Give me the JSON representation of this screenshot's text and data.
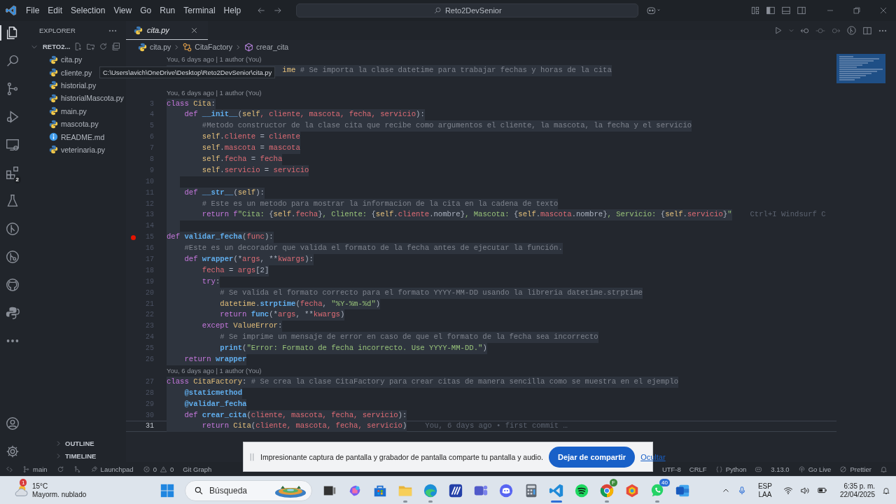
{
  "window": {
    "title": "Reto2DevSenior"
  },
  "menu": [
    "File",
    "Edit",
    "Selection",
    "View",
    "Go",
    "Run",
    "Terminal",
    "Help"
  ],
  "activity_bar": {
    "items": [
      {
        "kind": "files",
        "selected": true
      },
      {
        "kind": "search",
        "selected": false
      },
      {
        "kind": "scm",
        "selected": false
      },
      {
        "kind": "debug",
        "selected": false
      },
      {
        "kind": "remote",
        "selected": false
      },
      {
        "kind": "extensions",
        "selected": false,
        "badge": "2"
      },
      {
        "kind": "testing",
        "selected": false
      },
      {
        "kind": "gitgraph",
        "selected": false
      },
      {
        "kind": "gitlens",
        "selected": false
      },
      {
        "kind": "github",
        "selected": false
      },
      {
        "kind": "python",
        "selected": false
      },
      {
        "kind": "more",
        "selected": false
      }
    ],
    "bottom": [
      {
        "kind": "account"
      },
      {
        "kind": "settings"
      }
    ]
  },
  "sidebar": {
    "title": "EXPLORER",
    "folder": {
      "label": "RETO2...",
      "expanded": true
    },
    "files": [
      {
        "name": "cita.py",
        "kind": "python"
      },
      {
        "name": "cliente.py",
        "kind": "python"
      },
      {
        "name": "historial.py",
        "kind": "python"
      },
      {
        "name": "historialMascota.py",
        "kind": "python"
      },
      {
        "name": "main.py",
        "kind": "python"
      },
      {
        "name": "mascota.py",
        "kind": "python"
      },
      {
        "name": "README.md",
        "kind": "info"
      },
      {
        "name": "veterinaria.py",
        "kind": "python"
      }
    ],
    "sections": [
      {
        "label": "OUTLINE",
        "expanded": false
      },
      {
        "label": "TIMELINE",
        "expanded": false
      }
    ]
  },
  "tooltip": {
    "text": "C:\\Users\\avich\\OneDrive\\Desktop\\Reto2DevSenior\\cita.py"
  },
  "editor": {
    "tabs": [
      {
        "label": "cita.py",
        "selected": true,
        "preview": true
      }
    ],
    "breadcrumb": [
      {
        "label": "cita.py",
        "kind": "file"
      },
      {
        "label": "CitaFactory",
        "kind": "class"
      },
      {
        "label": "crear_cita",
        "kind": "method"
      }
    ],
    "rows": [
      {
        "kind": "lens",
        "text": "You, 6 days ago | 1 author (You)"
      },
      {
        "kind": "code",
        "selected": true,
        "current": false,
        "breakpoint": false,
        "tokens": [
          {
            "kind": "c",
            "text": "                          ime"
          },
          {
            "kind": "m",
            "text": " # Se importa la clase datetime para trabajar fechas y horas de la cita"
          }
        ]
      },
      {
        "kind": "code",
        "selected": false,
        "current": false,
        "breakpoint": false,
        "tokens": []
      },
      {
        "kind": "lens",
        "text": "You, 6 days ago | 1 author (You)"
      },
      {
        "kind": "code",
        "number": "3",
        "selected": true,
        "current": false,
        "breakpoint": false,
        "tokens": [
          {
            "kind": "k",
            "text": "class"
          },
          {
            "kind": "c",
            "text": " Cita"
          },
          {
            "kind": "t",
            "text": ":"
          }
        ]
      },
      {
        "kind": "code",
        "number": "4",
        "selected": true,
        "current": false,
        "breakpoint": false,
        "tokens": [
          {
            "kind": "k",
            "text": "    def"
          },
          {
            "kind": "f",
            "text": " __init__"
          },
          {
            "kind": "t",
            "text": "("
          },
          {
            "kind": "s",
            "text": "self"
          },
          {
            "kind": "p",
            "text": ", cliente, mascota, fecha, servicio"
          },
          {
            "kind": "t",
            "text": "):"
          }
        ]
      },
      {
        "kind": "code",
        "number": "5",
        "selected": true,
        "current": false,
        "breakpoint": false,
        "tokens": [
          {
            "kind": "m",
            "text": "        #Metodo constructor de la clase cita que recibe como argumentos el cliente, la mascota, la fecha y el servicio"
          }
        ]
      },
      {
        "kind": "code",
        "number": "6",
        "selected": true,
        "current": false,
        "breakpoint": false,
        "tokens": [
          {
            "kind": "s",
            "text": "        self"
          },
          {
            "kind": "t",
            "text": "."
          },
          {
            "kind": "p",
            "text": "cliente"
          },
          {
            "kind": "t",
            "text": " = "
          },
          {
            "kind": "p",
            "text": "cliente"
          }
        ]
      },
      {
        "kind": "code",
        "number": "7",
        "selected": true,
        "current": false,
        "breakpoint": false,
        "tokens": [
          {
            "kind": "s",
            "text": "        self"
          },
          {
            "kind": "t",
            "text": "."
          },
          {
            "kind": "p",
            "text": "mascota"
          },
          {
            "kind": "t",
            "text": " = "
          },
          {
            "kind": "p",
            "text": "mascota"
          }
        ]
      },
      {
        "kind": "code",
        "number": "8",
        "selected": true,
        "current": false,
        "breakpoint": false,
        "tokens": [
          {
            "kind": "s",
            "text": "        self"
          },
          {
            "kind": "t",
            "text": "."
          },
          {
            "kind": "p",
            "text": "fecha"
          },
          {
            "kind": "t",
            "text": " = "
          },
          {
            "kind": "p",
            "text": "fecha"
          }
        ]
      },
      {
        "kind": "code",
        "number": "9",
        "selected": true,
        "current": false,
        "breakpoint": false,
        "tokens": [
          {
            "kind": "s",
            "text": "        self"
          },
          {
            "kind": "t",
            "text": "."
          },
          {
            "kind": "p",
            "text": "servicio"
          },
          {
            "kind": "t",
            "text": " = "
          },
          {
            "kind": "p",
            "text": "servicio"
          }
        ]
      },
      {
        "kind": "code",
        "number": "10",
        "selected": true,
        "current": false,
        "breakpoint": false,
        "tokens": []
      },
      {
        "kind": "code",
        "number": "11",
        "selected": true,
        "current": false,
        "breakpoint": false,
        "tokens": [
          {
            "kind": "k",
            "text": "    def"
          },
          {
            "kind": "f",
            "text": " __str__"
          },
          {
            "kind": "t",
            "text": "("
          },
          {
            "kind": "s",
            "text": "self"
          },
          {
            "kind": "t",
            "text": "):"
          }
        ]
      },
      {
        "kind": "code",
        "number": "12",
        "selected": true,
        "current": false,
        "breakpoint": false,
        "tokens": [
          {
            "kind": "m",
            "text": "        # Este es un metodo para mostrar la informacion de la cita en la cadena de texto"
          }
        ]
      },
      {
        "kind": "code",
        "number": "13",
        "selected": true,
        "current": false,
        "breakpoint": false,
        "ghost": "Ctrl+I Windsurf C",
        "tokens": [
          {
            "kind": "k",
            "text": "        return f"
          },
          {
            "kind": "g",
            "text": "\"Cita: "
          },
          {
            "kind": "t",
            "text": "{"
          },
          {
            "kind": "s",
            "text": "self"
          },
          {
            "kind": "t",
            "text": "."
          },
          {
            "kind": "p",
            "text": "fecha"
          },
          {
            "kind": "t",
            "text": "}"
          },
          {
            "kind": "g",
            "text": ", Cliente: "
          },
          {
            "kind": "t",
            "text": "{"
          },
          {
            "kind": "s",
            "text": "self"
          },
          {
            "kind": "t",
            "text": "."
          },
          {
            "kind": "p",
            "text": "cliente"
          },
          {
            "kind": "t",
            "text": ".nombre}"
          },
          {
            "kind": "g",
            "text": ", Mascota: "
          },
          {
            "kind": "t",
            "text": "{"
          },
          {
            "kind": "s",
            "text": "self"
          },
          {
            "kind": "t",
            "text": "."
          },
          {
            "kind": "p",
            "text": "mascota"
          },
          {
            "kind": "t",
            "text": ".nombre}"
          },
          {
            "kind": "g",
            "text": ", Servicio: "
          },
          {
            "kind": "t",
            "text": "{"
          },
          {
            "kind": "s",
            "text": "self"
          },
          {
            "kind": "t",
            "text": "."
          },
          {
            "kind": "p",
            "text": "servicio"
          },
          {
            "kind": "t",
            "text": "}"
          },
          {
            "kind": "g",
            "text": "\""
          }
        ]
      },
      {
        "kind": "code",
        "number": "14",
        "selected": true,
        "current": false,
        "breakpoint": false,
        "tokens": []
      },
      {
        "kind": "code",
        "number": "15",
        "selected": true,
        "current": false,
        "breakpoint": true,
        "tokens": [
          {
            "kind": "k",
            "text": "def"
          },
          {
            "kind": "f",
            "text": " validar_fecha"
          },
          {
            "kind": "t",
            "text": "("
          },
          {
            "kind": "p",
            "text": "func"
          },
          {
            "kind": "t",
            "text": "):"
          }
        ]
      },
      {
        "kind": "code",
        "number": "16",
        "selected": true,
        "current": false,
        "breakpoint": false,
        "tokens": [
          {
            "kind": "m",
            "text": "    #Este es un decorador que valida el formato de la fecha antes de ejecutar la función."
          }
        ]
      },
      {
        "kind": "code",
        "number": "17",
        "selected": true,
        "current": false,
        "breakpoint": false,
        "tokens": [
          {
            "kind": "k",
            "text": "    def"
          },
          {
            "kind": "f",
            "text": " wrapper"
          },
          {
            "kind": "t",
            "text": "(*"
          },
          {
            "kind": "p",
            "text": "args"
          },
          {
            "kind": "t",
            "text": ", **"
          },
          {
            "kind": "p",
            "text": "kwargs"
          },
          {
            "kind": "t",
            "text": "):"
          }
        ]
      },
      {
        "kind": "code",
        "number": "18",
        "selected": true,
        "current": false,
        "breakpoint": false,
        "tokens": [
          {
            "kind": "p",
            "text": "        fecha"
          },
          {
            "kind": "t",
            "text": " = "
          },
          {
            "kind": "p",
            "text": "args"
          },
          {
            "kind": "t",
            "text": "[2]"
          }
        ]
      },
      {
        "kind": "code",
        "number": "19",
        "selected": true,
        "current": false,
        "breakpoint": false,
        "tokens": [
          {
            "kind": "k",
            "text": "        try"
          },
          {
            "kind": "t",
            "text": ":"
          }
        ]
      },
      {
        "kind": "code",
        "number": "20",
        "selected": true,
        "current": false,
        "breakpoint": false,
        "tokens": [
          {
            "kind": "m",
            "text": "            # Se valida el formato correcto para el formato YYYY-MM-DD usando la libreria datetime.strptime"
          }
        ]
      },
      {
        "kind": "code",
        "number": "21",
        "selected": true,
        "current": false,
        "breakpoint": false,
        "tokens": [
          {
            "kind": "c",
            "text": "            datetime"
          },
          {
            "kind": "t",
            "text": "."
          },
          {
            "kind": "f",
            "text": "strptime"
          },
          {
            "kind": "t",
            "text": "("
          },
          {
            "kind": "p",
            "text": "fecha"
          },
          {
            "kind": "t",
            "text": ", "
          },
          {
            "kind": "g",
            "text": "\"%Y-%m-%d\""
          },
          {
            "kind": "t",
            "text": ")"
          }
        ]
      },
      {
        "kind": "code",
        "number": "22",
        "selected": true,
        "current": false,
        "breakpoint": false,
        "tokens": [
          {
            "kind": "k",
            "text": "            return"
          },
          {
            "kind": "f",
            "text": " func"
          },
          {
            "kind": "t",
            "text": "(*"
          },
          {
            "kind": "p",
            "text": "args"
          },
          {
            "kind": "t",
            "text": ", **"
          },
          {
            "kind": "p",
            "text": "kwargs"
          },
          {
            "kind": "t",
            "text": ")"
          }
        ]
      },
      {
        "kind": "code",
        "number": "23",
        "selected": true,
        "current": false,
        "breakpoint": false,
        "tokens": [
          {
            "kind": "k",
            "text": "        except"
          },
          {
            "kind": "c",
            "text": " ValueError"
          },
          {
            "kind": "t",
            "text": ":"
          }
        ]
      },
      {
        "kind": "code",
        "number": "24",
        "selected": true,
        "current": false,
        "breakpoint": false,
        "tokens": [
          {
            "kind": "m",
            "text": "            # Se imprime un mensaje de error en caso de que el formato de la fecha sea incorrecto"
          }
        ]
      },
      {
        "kind": "code",
        "number": "25",
        "selected": true,
        "current": false,
        "breakpoint": false,
        "tokens": [
          {
            "kind": "f",
            "text": "            print"
          },
          {
            "kind": "t",
            "text": "("
          },
          {
            "kind": "g",
            "text": "\"Error: Formato de fecha incorrecto. Use YYYY-MM-DD.\""
          },
          {
            "kind": "t",
            "text": ")"
          }
        ]
      },
      {
        "kind": "code",
        "number": "26",
        "selected": true,
        "current": false,
        "breakpoint": false,
        "tokens": [
          {
            "kind": "k",
            "text": "    return"
          },
          {
            "kind": "f",
            "text": " wrapper"
          }
        ]
      },
      {
        "kind": "lens",
        "text": "You, 6 days ago | 1 author (You)"
      },
      {
        "kind": "code",
        "number": "27",
        "selected": true,
        "current": false,
        "breakpoint": false,
        "tokens": [
          {
            "kind": "k",
            "text": "class"
          },
          {
            "kind": "c",
            "text": " CitaFactory"
          },
          {
            "kind": "t",
            "text": ":"
          },
          {
            "kind": "m",
            "text": " # Se crea la clase CitaFactory para crear citas de manera sencilla como se muestra en el ejemplo"
          }
        ]
      },
      {
        "kind": "code",
        "number": "28",
        "selected": true,
        "current": false,
        "breakpoint": false,
        "tokens": [
          {
            "kind": "d",
            "text": "    @staticmethod"
          }
        ]
      },
      {
        "kind": "code",
        "number": "29",
        "selected": true,
        "current": false,
        "breakpoint": false,
        "tokens": [
          {
            "kind": "d",
            "text": "    @validar_fecha"
          }
        ]
      },
      {
        "kind": "code",
        "number": "30",
        "selected": true,
        "current": false,
        "breakpoint": false,
        "tokens": [
          {
            "kind": "k",
            "text": "    def"
          },
          {
            "kind": "f",
            "text": " crear_cita"
          },
          {
            "kind": "t",
            "text": "("
          },
          {
            "kind": "p",
            "text": "cliente, mascota, fecha, servicio"
          },
          {
            "kind": "t",
            "text": "):"
          }
        ]
      },
      {
        "kind": "code",
        "number": "31",
        "selected": true,
        "current": true,
        "breakpoint": false,
        "ghost": "You, 6 days ago • first commit …",
        "tokens": [
          {
            "kind": "k",
            "text": "        return"
          },
          {
            "kind": "c",
            "text": " Cita"
          },
          {
            "kind": "t",
            "text": "("
          },
          {
            "kind": "p",
            "text": "cliente, mascota, fecha, servicio"
          },
          {
            "kind": "t",
            "text": ")"
          }
        ]
      }
    ]
  },
  "status_bar": {
    "left": [
      {
        "kind": "remote"
      },
      {
        "kind": "branch",
        "text": "main"
      },
      {
        "kind": "sync"
      },
      {
        "kind": "gitlens"
      },
      {
        "kind": "launchpad",
        "text": "Launchpad"
      },
      {
        "kind": "problems",
        "errors": "0",
        "warnings": "0"
      },
      {
        "kind": "text",
        "text": "Git Graph"
      }
    ],
    "right": [
      {
        "kind": "text",
        "text": "UTF-8"
      },
      {
        "kind": "text",
        "text": "CRLF"
      },
      {
        "kind": "language",
        "text": "Python"
      },
      {
        "kind": "copilot"
      },
      {
        "kind": "text",
        "text": "3.13.0"
      },
      {
        "kind": "golive",
        "text": "Go Live"
      },
      {
        "kind": "prettier",
        "text": "Prettier"
      },
      {
        "kind": "bell"
      }
    ]
  },
  "notification": {
    "message": "Impresionante captura de pantalla y grabador de pantalla comparte tu pantalla y audio.",
    "button": "Dejar de compartir",
    "link": "Ocultar"
  },
  "taskbar": {
    "weather": {
      "temperature": "15°C",
      "description": "Mayorm. nublado",
      "badge": "1"
    },
    "search": {
      "placeholder": "Búsqueda"
    },
    "apps": [
      {
        "kind": "taskview",
        "running": false
      },
      {
        "kind": "copilot",
        "running": false
      },
      {
        "kind": "store",
        "running": false
      },
      {
        "kind": "folder",
        "running": true
      },
      {
        "kind": "edge",
        "running": true
      },
      {
        "kind": "mapp",
        "running": false
      },
      {
        "kind": "teams",
        "running": false
      },
      {
        "kind": "discord",
        "running": false
      },
      {
        "kind": "calculator",
        "running": false
      },
      {
        "kind": "vscode",
        "running": true,
        "active": true
      },
      {
        "kind": "spotify",
        "running": false
      },
      {
        "kind": "chrome",
        "running": true,
        "badge": "F"
      },
      {
        "kind": "hexagon",
        "running": false
      },
      {
        "kind": "whatsapp",
        "running": true,
        "badge": "40"
      },
      {
        "kind": "word",
        "running": false
      }
    ],
    "language": [
      "ESP",
      "LAA"
    ],
    "time": "6:35 p. m.",
    "date": "22/04/2025"
  }
}
